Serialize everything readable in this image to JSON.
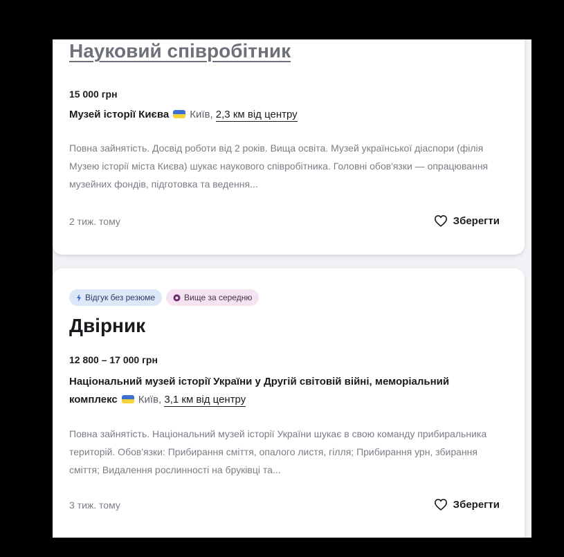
{
  "vacancies": [
    {
      "title": "Науковий співробітник",
      "salary": "15 000 грн",
      "company": "Музей історії Києва",
      "city": "Київ,",
      "distance": "2,3 км від центру",
      "description": "Повна зайнятість. Досвід роботи від 2 років. Вища освіта. Музей української діаспори (філія Музею історії міста Києва) шукає наукового співробітника. Головні обов'язки — опрацювання музейних фондів, підготовка та ведення...",
      "posted": "2 тиж. тому",
      "save_label": "Зберегти"
    },
    {
      "tags": [
        "Відгук без резюме",
        "Вище за середню"
      ],
      "title": "Двірник",
      "salary": "12 800 – 17 000 грн",
      "company": "Національний музей історії України у Другій світовій війні, меморіальний комплекс",
      "city": "Київ,",
      "distance": "3,1 км від центру",
      "description": "Повна зайнятість. Національний музей історії України шукає в свою команду прибиральника територій. Обов'язки: Прибирання сміття, опалого листя, гілля; Прибирання урн, збирання сміття; Видалення рослинності на бруківці та...",
      "posted": "3 тиж. тому",
      "save_label": "Зберегти"
    }
  ],
  "colors": {
    "background": "#000000",
    "panel": "#f1f2f5",
    "card": "#ffffff",
    "muted_text": "#7a7d85",
    "tag_blue": "#dce7f8",
    "tag_pink": "#f5e3f2"
  },
  "icons": {
    "save": "heart-outline-icon",
    "tag_fast": "lightning-icon",
    "tag_salary": "coin-icon",
    "flag": "ukraine-flag-icon"
  }
}
